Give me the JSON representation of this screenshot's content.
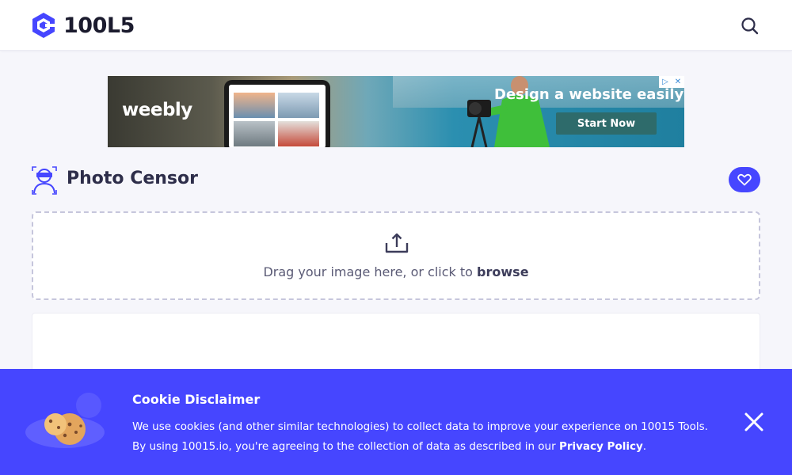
{
  "header": {
    "logo_text": "100L5",
    "search_icon": "search-icon"
  },
  "ad": {
    "brand": "weebly",
    "headline": "Design a website easily",
    "cta": "Start Now"
  },
  "tool": {
    "title": "Photo Censor",
    "icon": "censor-person-icon",
    "favorite_icon": "heart-icon"
  },
  "dropzone": {
    "text": "Drag your image here, or click to",
    "link": "browse",
    "icon": "upload-icon"
  },
  "cookie": {
    "title": "Cookie Disclaimer",
    "text": "We use cookies (and other similar technologies) to collect data to improve your experience on 10015 Tools. By using 10015.io, you're agreeing to the collection of data as described in our",
    "link": "Privacy Policy",
    "suffix": ".",
    "close_icon": "close-icon"
  },
  "colors": {
    "accent": "#4646ff",
    "background": "#f6f6fb",
    "text": "#3c3c5a"
  }
}
